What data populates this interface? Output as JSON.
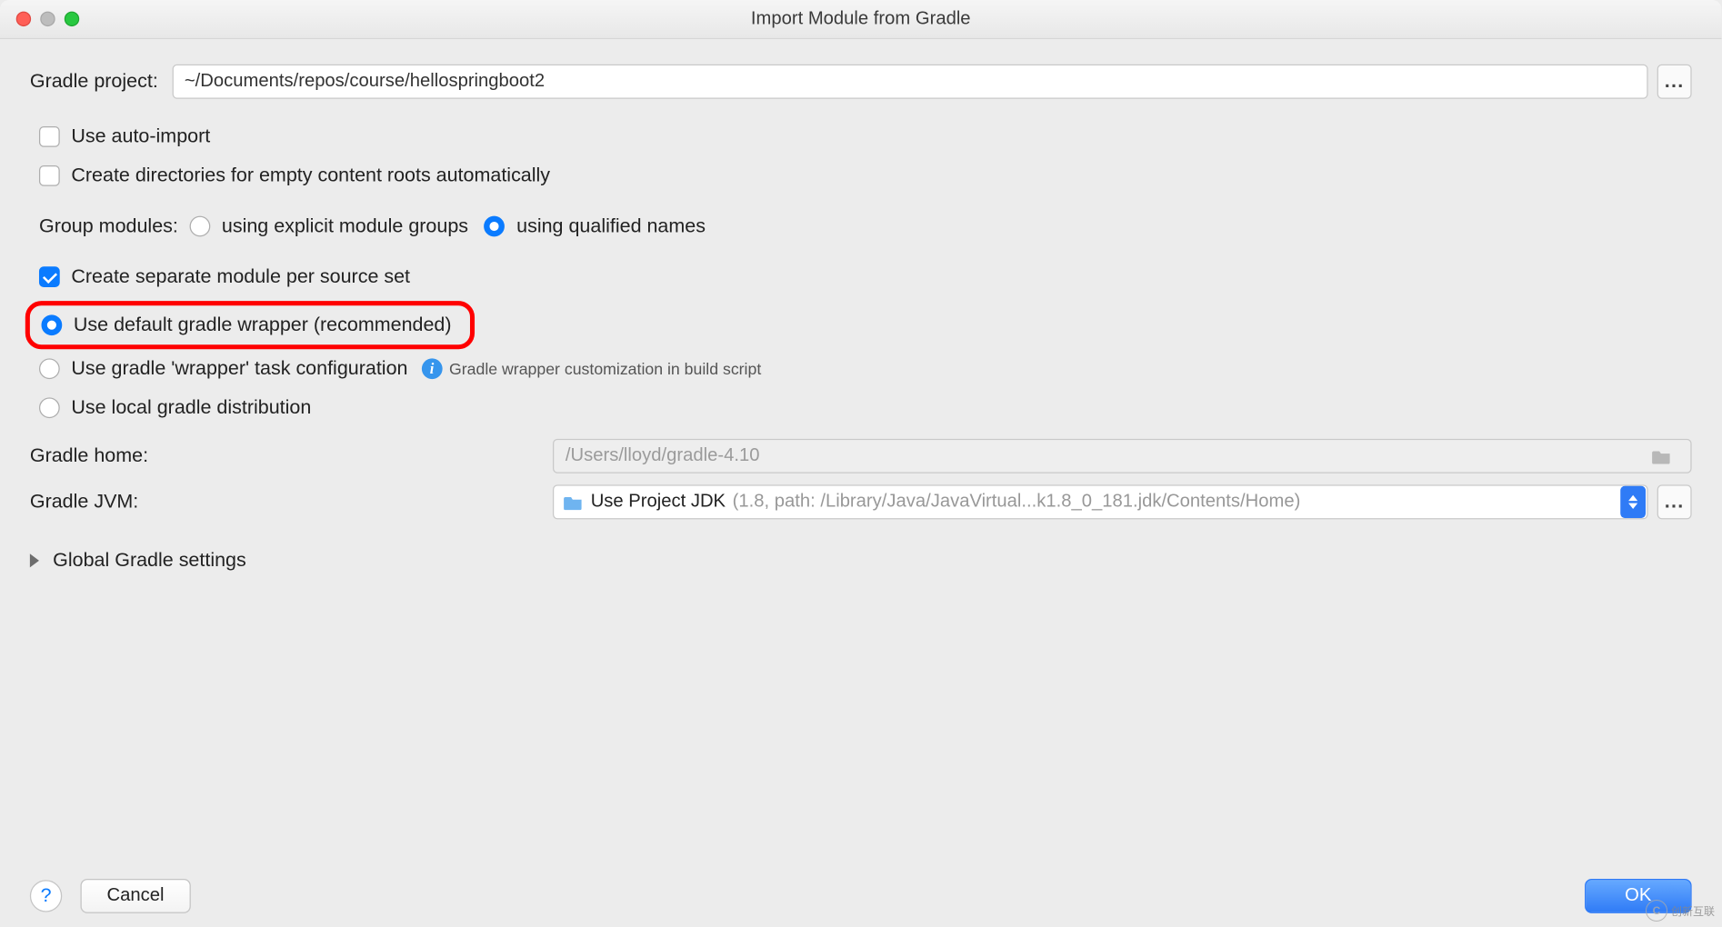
{
  "window": {
    "title": "Import Module from Gradle"
  },
  "gradleProject": {
    "label": "Gradle project:",
    "value": "~/Documents/repos/course/hellospringboot2"
  },
  "options": {
    "autoImport": "Use auto-import",
    "createDirs": "Create directories for empty content roots automatically",
    "groupModulesLabel": "Group modules:",
    "explicitGroups": "using explicit module groups",
    "qualifiedNames": "using qualified names",
    "separateModule": "Create separate module per source set",
    "defaultWrapper": "Use default gradle wrapper (recommended)",
    "wrapperTask": "Use gradle 'wrapper' task configuration",
    "wrapperHint": "Gradle wrapper customization in build script",
    "localDist": "Use local gradle distribution"
  },
  "gradleHome": {
    "label": "Gradle home:",
    "value": "/Users/lloyd/gradle-4.10"
  },
  "gradleJvm": {
    "label": "Gradle JVM:",
    "value": "Use Project JDK",
    "detail": "(1.8, path: /Library/Java/JavaVirtual...k1.8_0_181.jdk/Contents/Home)"
  },
  "expander": {
    "label": "Global Gradle settings"
  },
  "footer": {
    "cancel": "Cancel",
    "ok": "OK"
  },
  "watermark": "创新互联"
}
